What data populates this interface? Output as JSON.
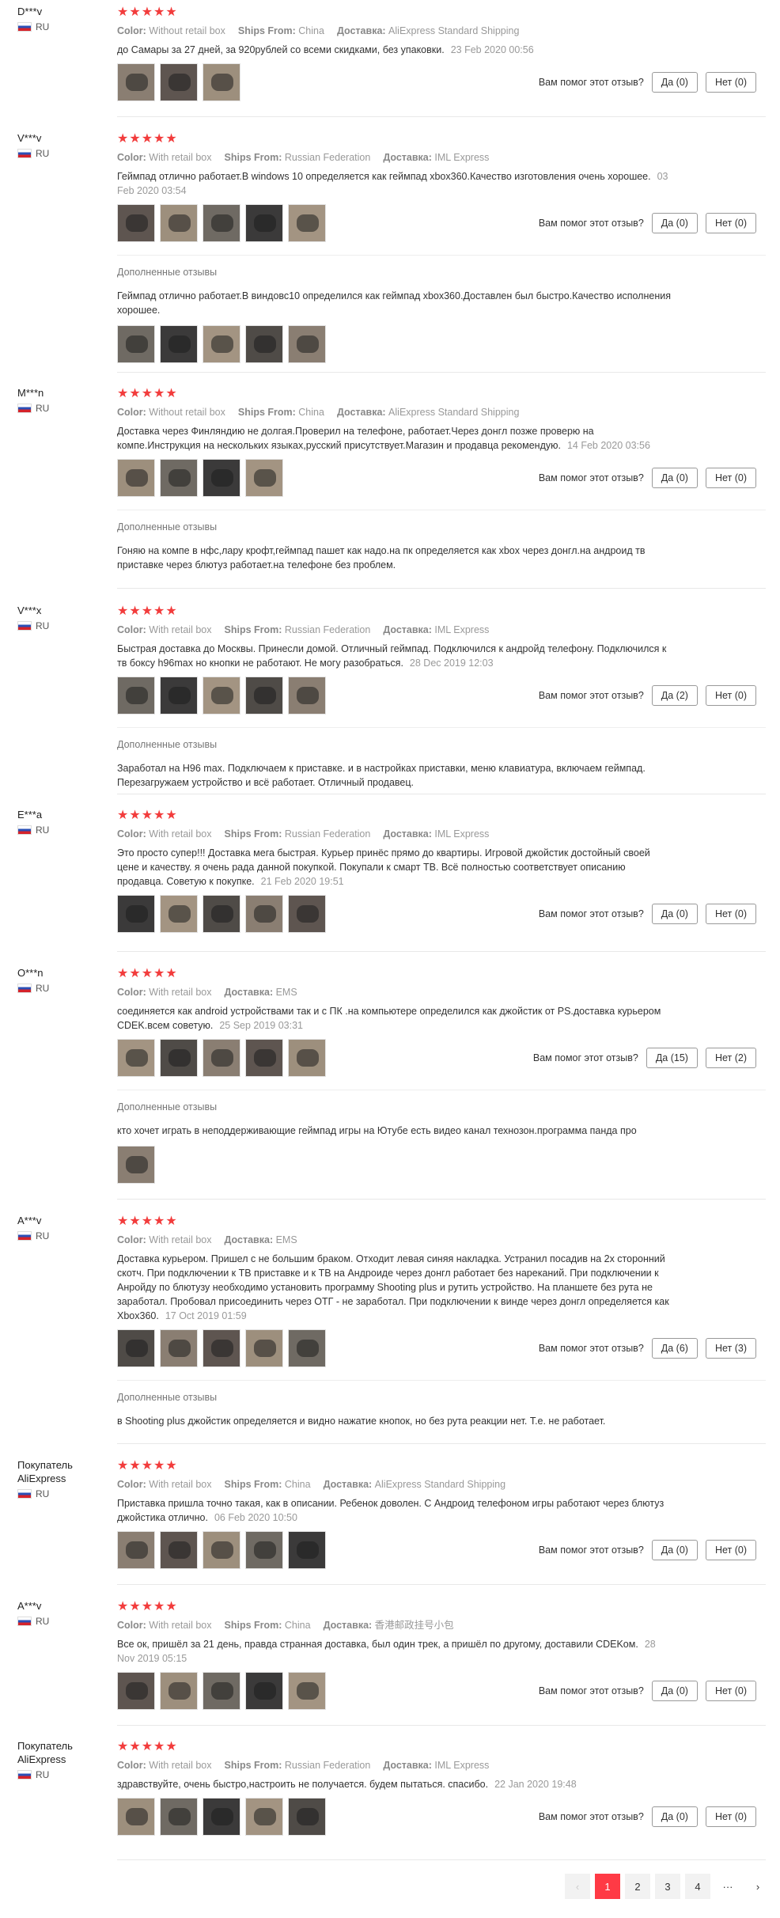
{
  "helpful_label": "Вам помог этот отзыв?",
  "additional_label": "Дополненные отзывы",
  "reviews": [
    {
      "name": "D***v",
      "country": "RU",
      "stars": "★★★★★",
      "color": "Without retail box",
      "ships_from": "China",
      "delivery": "AliExpress Standard Shipping",
      "text": "до Самары за 27 дней, за 920рублей со всеми скидками, без упаковки.",
      "date": "23 Feb 2020 00:56",
      "yes": "Да (0)",
      "no": "Нет (0)"
    },
    {
      "name": "V***v",
      "country": "RU",
      "stars": "★★★★★",
      "color": "With retail box",
      "ships_from": "Russian Federation",
      "delivery": "IML Express",
      "text": "Геймпад отлично работает.В windows 10 определяется как геймпад xbox360.Качество изготовления очень хорошее.",
      "date": "03 Feb 2020 03:54",
      "yes": "Да (0)",
      "no": "Нет (0)",
      "extra_text": "Геймпад отлично работает.В виндовс10 определился как геймпад xbox360.Доставлен был быстро.Качество исполнения хорошее."
    },
    {
      "name": "M***n",
      "country": "RU",
      "stars": "★★★★★",
      "color": "Without retail box",
      "ships_from": "China",
      "delivery": "AliExpress Standard Shipping",
      "text": "Доставка через Финляндию не долгая.Проверил на телефоне, работает.Через донгл позже проверю на компе.Инструкция на нескольких языках,русский присутствует.Магазин и продавца рекомендую.",
      "date": "14 Feb 2020 03:56",
      "yes": "Да (0)",
      "no": "Нет (0)",
      "extra_text": "Гоняю на компе в нфс,лару крофт,геймпад пашет как надо.на пк определяется как xbox через донгл.на андроид тв приставке через блютуз работает.на телефоне без проблем."
    },
    {
      "name": "V***x",
      "country": "RU",
      "stars": "★★★★★",
      "color": "With retail box",
      "ships_from": "Russian Federation",
      "delivery": "IML Express",
      "text": "Быстрая доставка до Москвы. Принесли домой. Отличный геймпад. Подключился к андройд телефону. Подключился к тв боксу h96max но кнопки не работают. Не могу разобраться.",
      "date": "28 Dec 2019 12:03",
      "yes": "Да (2)",
      "no": "Нет (0)",
      "extra_text": "Заработал на H96 max. Подключаем к приставке. и в настройках приставки, меню клавиатура, включаем геймпад. Перезагружаем устройство и всё работает. Отличный продавец."
    },
    {
      "name": "E***a",
      "country": "RU",
      "stars": "★★★★★",
      "color": "With retail box",
      "ships_from": "Russian Federation",
      "delivery": "IML Express",
      "text": "Это просто супер!!! Доставка мега быстрая. Курьер принёс прямо до квартиры. Игровой джойстик достойный своей цене и качеству. я очень рада данной покупкой. Покупали к смарт ТВ. Всё полностью соответствует описанию продавца. Советую к покупке.",
      "date": "21 Feb 2020 19:51",
      "yes": "Да (0)",
      "no": "Нет (0)"
    },
    {
      "name": "O***n",
      "country": "RU",
      "stars": "★★★★★",
      "color": "With retail box",
      "delivery": "EMS",
      "text": "соединяется как android устройствами так и с ПК .на компьютере определился как джойстик от PS.доставка курьером CDEK.всем советую.",
      "date": "25 Sep 2019 03:31",
      "yes": "Да (15)",
      "no": "Нет (2)",
      "extra_text": "кто хочет играть в неподдерживающие геймпад игры на Ютубе есть видео канал технозон.программа панда про"
    },
    {
      "name": "A***v",
      "country": "RU",
      "stars": "★★★★★",
      "color": "With retail box",
      "delivery": "EMS",
      "text": "Доставка курьером. Пришел с не большим браком. Отходит левая синяя накладка. Устранил посадив на 2х сторонний скотч. При подключении к ТВ приставке и к ТВ на Андроиде через донгл работает без нареканий. При подключении к Анройду по блютузу необходимо установить программу Shooting plus и рутить устройство. На планшете без рута не заработал. Пробовал присоединить через ОТГ - не заработал. При подключении к винде через донгл определяется как Xbox360.",
      "date": "17 Oct 2019 01:59",
      "yes": "Да (6)",
      "no": "Нет (3)",
      "extra_text": "в Shooting plus джойстик определяется и видно нажатие кнопок, но без рута реакции нет. Т.е. не работает."
    },
    {
      "name": "Покупатель AliExpress",
      "country": "RU",
      "stars": "★★★★★",
      "color": "With retail box",
      "ships_from": "China",
      "delivery": "AliExpress Standard Shipping",
      "text": "Приставка пришла точно такая, как в описании. Ребенок доволен. С Андроид телефоном игры работают через блютуз джойстика отлично.",
      "date": "06 Feb 2020 10:50",
      "yes": "Да (0)",
      "no": "Нет (0)"
    },
    {
      "name": "A***v",
      "country": "RU",
      "stars": "★★★★★",
      "color": "With retail box",
      "ships_from": "China",
      "delivery": "香港邮政挂号小包",
      "text": "Все ок, пришёл за 21 день, правда странная доставка, был один трек, а пришёл по другому, доставили CDEKом.",
      "date": "28 Nov 2019 05:15",
      "yes": "Да (0)",
      "no": "Нет (0)"
    },
    {
      "name": "Покупатель AliExpress",
      "country": "RU",
      "stars": "★★★★★",
      "color": "With retail box",
      "ships_from": "Russian Federation",
      "delivery": "IML Express",
      "text": "здравствуйте, очень быстро,настроить не получается. будем пытаться. спасибо.",
      "date": "22 Jan 2020 19:48",
      "yes": "Да (0)",
      "no": "Нет (0)"
    }
  ],
  "labels": {
    "color": "Color:",
    "ships_from": "Ships From:",
    "delivery": "Доставка:"
  },
  "pagination": {
    "prev": "‹",
    "pages": [
      "1",
      "2",
      "3",
      "4"
    ],
    "ellipsis": "···",
    "next": "›",
    "active": "1"
  }
}
